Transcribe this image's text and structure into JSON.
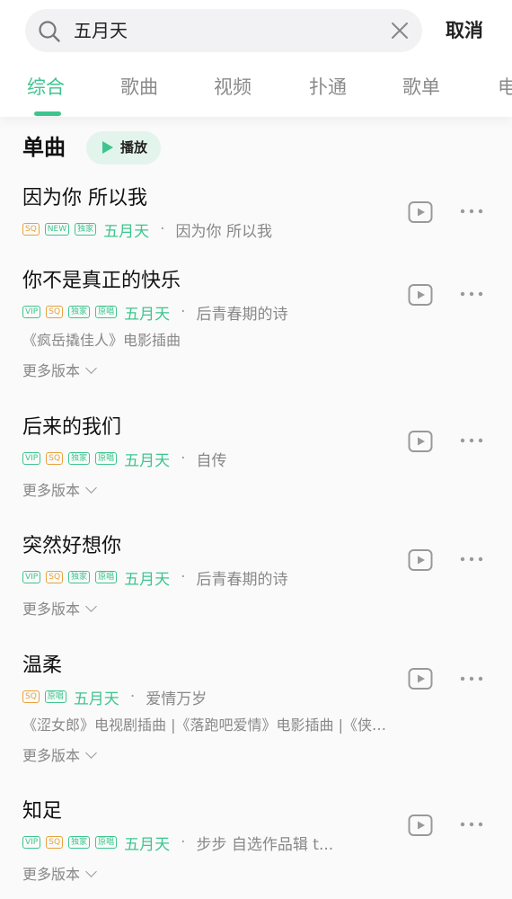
{
  "search": {
    "query": "五月天",
    "cancel_label": "取消"
  },
  "tabs": [
    {
      "label": "综合",
      "active": true
    },
    {
      "label": "歌曲",
      "active": false
    },
    {
      "label": "视频",
      "active": false
    },
    {
      "label": "扑通",
      "active": false
    },
    {
      "label": "歌单",
      "active": false
    },
    {
      "label": "电",
      "active": false
    }
  ],
  "section": {
    "title": "单曲",
    "play_label": "播放"
  },
  "songs": [
    {
      "title": "因为你 所以我",
      "badges": [
        "SQ",
        "NEW",
        "独家"
      ],
      "artist": "五月天",
      "separator": "·",
      "album": "因为你 所以我",
      "desc": "",
      "more": ""
    },
    {
      "title": "你不是真正的快乐",
      "badges": [
        "VIP",
        "SQ",
        "独家",
        "原唱"
      ],
      "artist": "五月天",
      "separator": "·",
      "album": "后青春期的诗",
      "desc": "《疯岳撬佳人》电影插曲",
      "more": "更多版本"
    },
    {
      "title": "后来的我们",
      "badges": [
        "VIP",
        "SQ",
        "独家",
        "原唱"
      ],
      "artist": "五月天",
      "separator": "·",
      "album": "自传",
      "desc": "",
      "more": "更多版本"
    },
    {
      "title": "突然好想你",
      "badges": [
        "VIP",
        "SQ",
        "独家",
        "原唱"
      ],
      "artist": "五月天",
      "separator": "·",
      "album": "后青春期的诗",
      "desc": "",
      "more": "更多版本"
    },
    {
      "title": "温柔",
      "badges": [
        "SQ",
        "原唱"
      ],
      "artist": "五月天",
      "separator": "·",
      "album": "爱情万岁",
      "desc": "《涩女郎》电视剧插曲 |《落跑吧爱情》电影插曲 |《侠…",
      "more": "更多版本"
    },
    {
      "title": "知足",
      "badges": [
        "VIP",
        "SQ",
        "独家",
        "原唱"
      ],
      "artist": "五月天",
      "separator": "·",
      "album": "步步 自选作品辑 t...",
      "desc": "",
      "more": "更多版本"
    }
  ],
  "colors": {
    "accent": "#3ec58f",
    "sq_badge": "#e6a23c",
    "secondary_text": "#888888"
  }
}
